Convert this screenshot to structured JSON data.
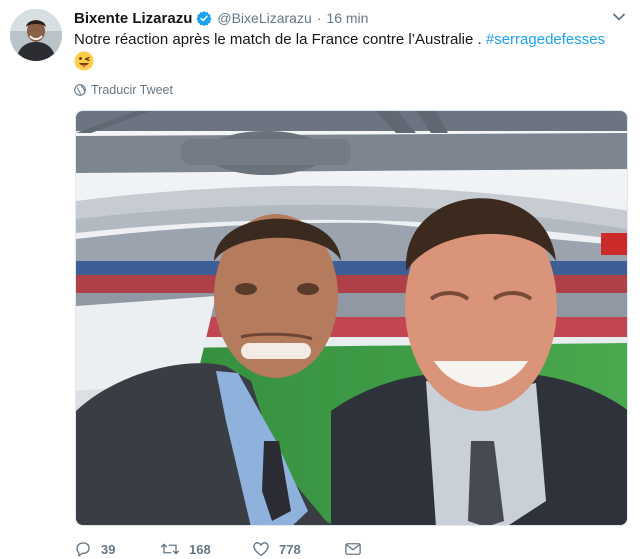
{
  "tweet": {
    "author": {
      "display_name": "Bixente Lizarazu",
      "handle": "@BixeLizarazu",
      "verified": true
    },
    "separator": "·",
    "time": "16 min",
    "text": "Notre réaction après le match de la France contre l’Australie .",
    "hashtag": "#serragedefesses",
    "emoji": "winking-face-with-tongue",
    "translate_label": "Traducir Tweet",
    "media": {
      "type": "photo"
    },
    "actions": {
      "reply_count": "39",
      "retweet_count": "168",
      "like_count": "778"
    }
  },
  "colors": {
    "link": "#1da1f2",
    "secondary_text": "#657786",
    "primary_text": "#14171a",
    "verified": "#1da1f2"
  },
  "icons": [
    "verified-icon",
    "chevron-down-icon",
    "globe-icon",
    "reply-icon",
    "retweet-icon",
    "like-icon",
    "message-icon"
  ]
}
